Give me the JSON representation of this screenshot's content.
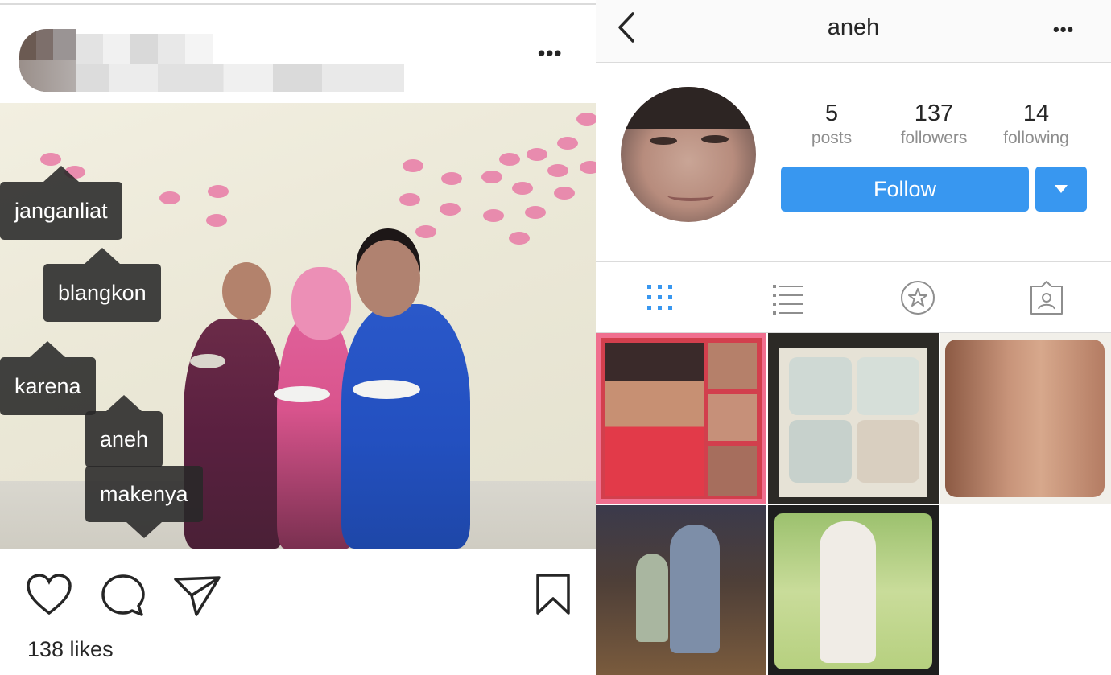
{
  "post": {
    "tags": [
      "janganliat",
      "blangkon",
      "karena",
      "aneh",
      "makenya"
    ],
    "likes": "138 likes"
  },
  "profile": {
    "username": "aneh",
    "stats": [
      {
        "num": "5",
        "label": "posts"
      },
      {
        "num": "137",
        "label": "followers"
      },
      {
        "num": "14",
        "label": "following"
      }
    ],
    "follow_label": "Follow"
  },
  "icons": {
    "post": [
      "more-dots-icon",
      "heart-icon",
      "comment-icon",
      "share-icon",
      "bookmark-icon"
    ],
    "profile": [
      "back-chevron-icon",
      "more-dots-icon",
      "dropdown-caret-icon",
      "grid-view-icon",
      "list-view-icon",
      "star-icon",
      "tagged-user-icon"
    ]
  },
  "colors": {
    "accent": "#3897f0",
    "tag_bg": "#282828",
    "muted": "#8e8e8e"
  }
}
